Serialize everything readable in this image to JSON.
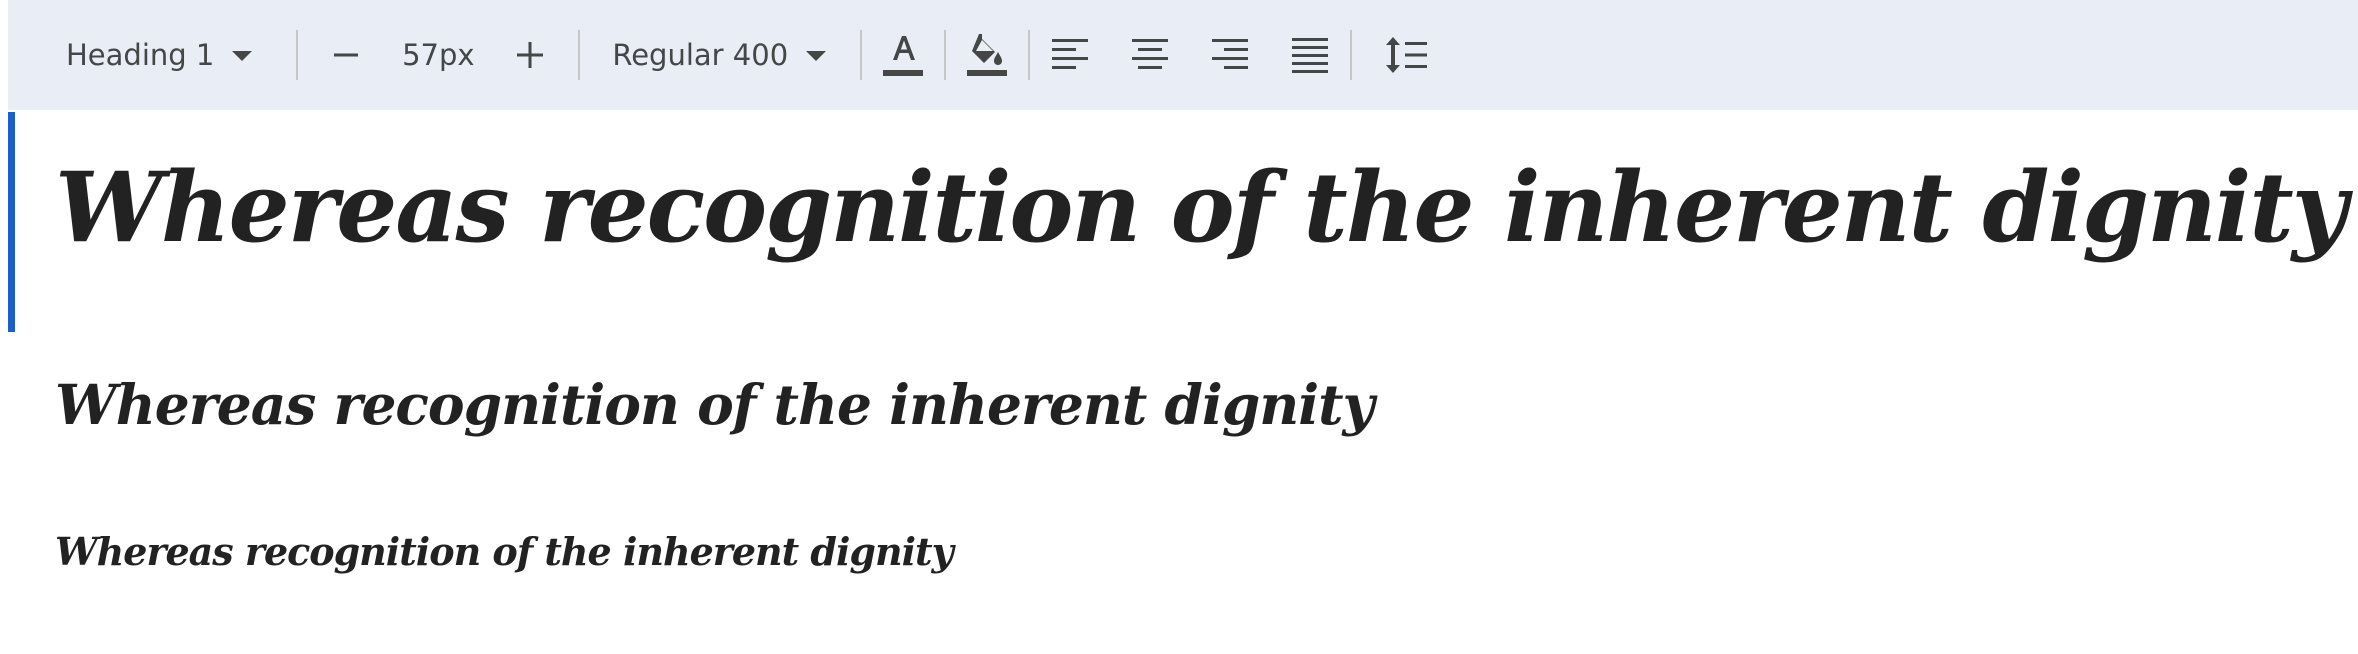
{
  "toolbar": {
    "style_select": {
      "value": "Heading 1",
      "icon": "chevron-down-icon"
    },
    "font_size": {
      "decrease_icon": "minus-icon",
      "value": "57px",
      "increase_icon": "plus-icon"
    },
    "weight_select": {
      "value": "Regular 400",
      "icon": "chevron-down-icon"
    },
    "text_color_icon": "text-color-icon",
    "highlight_icon": "paint-bucket-icon",
    "align_icons": [
      "align-left-icon",
      "align-center-icon",
      "align-right-icon",
      "align-justify-icon"
    ],
    "line_spacing_icon": "line-spacing-icon",
    "colors": {
      "background": "#e9edf5",
      "icon": "#444746",
      "separator": "#c4c7c5"
    }
  },
  "document": {
    "focus_color": "#1a5fcb",
    "headings": [
      {
        "level": "h1",
        "text": "Whereas recognition of the inherent dignity"
      },
      {
        "level": "h2",
        "text": "Whereas recognition of the inherent dignity"
      },
      {
        "level": "h3",
        "text": "Whereas recognition of the inherent dignity"
      }
    ]
  }
}
